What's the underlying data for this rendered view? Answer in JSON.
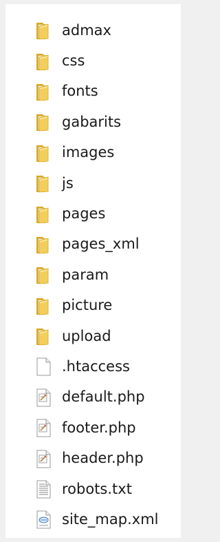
{
  "file_list": {
    "items": [
      {
        "label": "admax",
        "type": "folder",
        "icon": "folder-icon"
      },
      {
        "label": "css",
        "type": "folder",
        "icon": "folder-icon"
      },
      {
        "label": "fonts",
        "type": "folder",
        "icon": "folder-icon"
      },
      {
        "label": "gabarits",
        "type": "folder",
        "icon": "folder-icon"
      },
      {
        "label": "images",
        "type": "folder",
        "icon": "folder-icon"
      },
      {
        "label": "js",
        "type": "folder",
        "icon": "folder-icon"
      },
      {
        "label": "pages",
        "type": "folder",
        "icon": "folder-icon"
      },
      {
        "label": "pages_xml",
        "type": "folder",
        "icon": "folder-icon"
      },
      {
        "label": "param",
        "type": "folder",
        "icon": "folder-icon"
      },
      {
        "label": "picture",
        "type": "folder",
        "icon": "folder-icon"
      },
      {
        "label": "upload",
        "type": "folder",
        "icon": "folder-icon"
      },
      {
        "label": ".htaccess",
        "type": "file",
        "icon": "blank-file-icon"
      },
      {
        "label": "default.php",
        "type": "file",
        "icon": "php-file-icon"
      },
      {
        "label": "footer.php",
        "type": "file",
        "icon": "php-file-icon"
      },
      {
        "label": "header.php",
        "type": "file",
        "icon": "php-file-icon"
      },
      {
        "label": "robots.txt",
        "type": "file",
        "icon": "text-file-icon"
      },
      {
        "label": "site_map.xml",
        "type": "file",
        "icon": "xml-file-icon"
      }
    ]
  },
  "colors": {
    "background": "#f0f0f0",
    "pane": "#ffffff",
    "folder_body": "#f2cf5c",
    "folder_shade": "#d9a925",
    "text": "#1a1a1a"
  }
}
